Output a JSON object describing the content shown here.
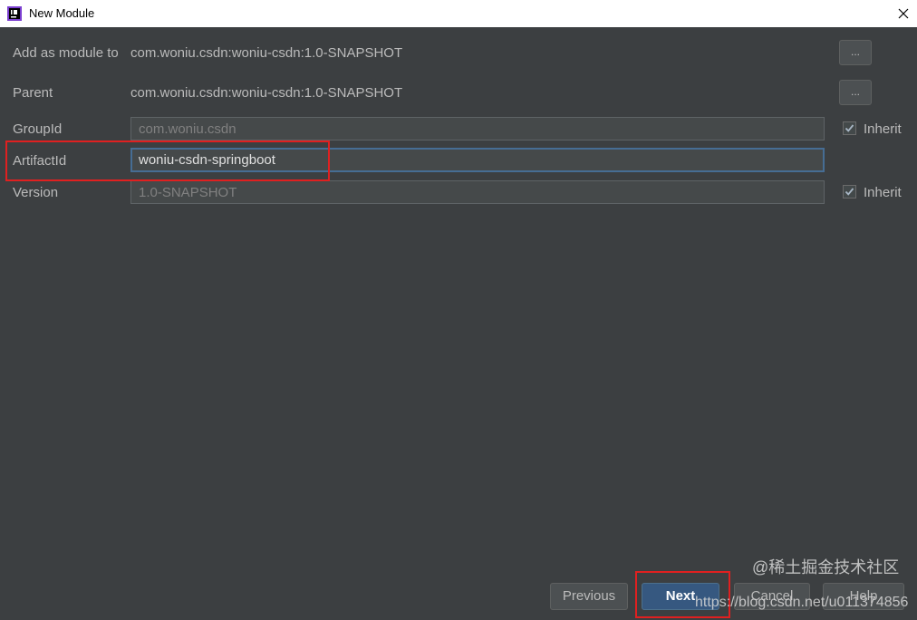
{
  "window": {
    "title": "New Module"
  },
  "form": {
    "add_as_module_label": "Add as module to",
    "add_as_module_value": "com.woniu.csdn:woniu-csdn:1.0-SNAPSHOT",
    "parent_label": "Parent",
    "parent_value": "com.woniu.csdn:woniu-csdn:1.0-SNAPSHOT",
    "browse_label": "...",
    "groupid_label": "GroupId",
    "groupid_value": "com.woniu.csdn",
    "artifactid_label": "ArtifactId",
    "artifactid_value": "woniu-csdn-springboot",
    "version_label": "Version",
    "version_value": "1.0-SNAPSHOT",
    "inherit_label": "Inherit",
    "groupid_inherit_checked": true,
    "version_inherit_checked": true
  },
  "buttons": {
    "previous": "Previous",
    "next": "Next",
    "cancel": "Cancel",
    "help": "Help"
  },
  "watermark": {
    "site": "@稀土掘金技术社区",
    "url": "https://blog.csdn.net/u011374856"
  },
  "colors": {
    "background": "#3c3f41",
    "accent": "#365880",
    "highlight": "#e02020"
  }
}
